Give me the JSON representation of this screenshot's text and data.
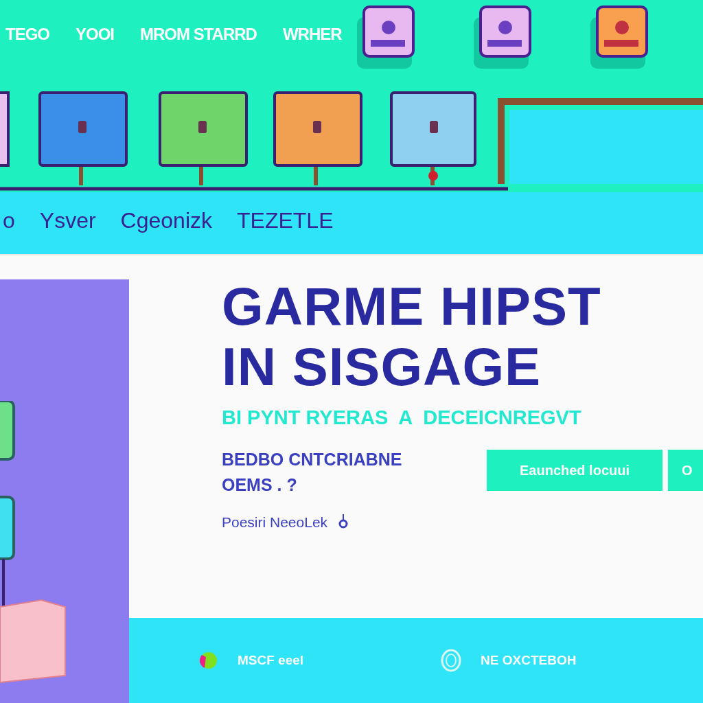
{
  "nav": {
    "links": [
      "TEGO",
      "YOOI",
      "MROM STARRD",
      "WRHER"
    ]
  },
  "tabs": [
    {
      "label": "o",
      "selected": false
    },
    {
      "label": "Ysver",
      "selected": false
    },
    {
      "label": "Cgeonizk",
      "selected": false
    },
    {
      "label": "TEZETLE",
      "selected": false
    }
  ],
  "hero": {
    "title_lines": [
      "GARME HIPST",
      "IN SISGAGE"
    ],
    "subtitle": "BI PYNT RYERAS  A  DECEICNREGVT",
    "info_lines": [
      "BEDBO CNTCRIABNE",
      "OEMS . ?"
    ],
    "byline": "Poesiri NeeoLek",
    "buttons": [
      "Eaunched locuui",
      "O"
    ]
  },
  "footer": {
    "items": [
      {
        "kind": "ball",
        "label": "MSCF eeel"
      },
      {
        "kind": "badge",
        "label": "NE OXCTEBOH"
      }
    ]
  }
}
